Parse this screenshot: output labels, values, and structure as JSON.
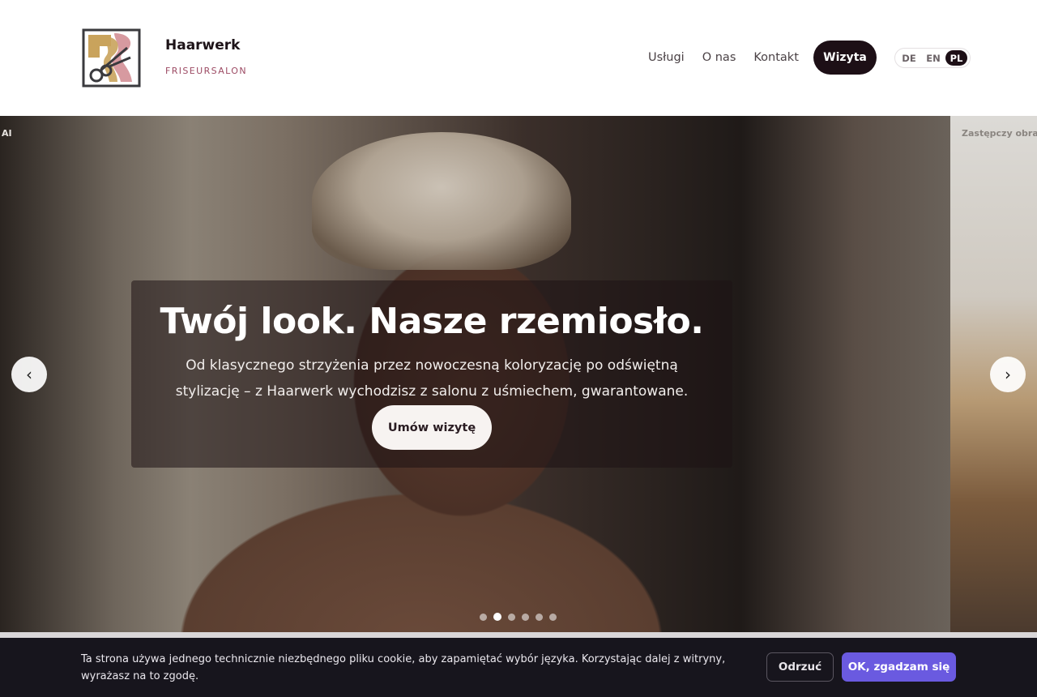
{
  "header": {
    "logo_icon": "scissors-logo-icon",
    "brand_name": "Haarwerk",
    "brand_sub": "FRISEURSALON",
    "nav": [
      "Usługi",
      "O nas",
      "Kontakt"
    ],
    "cta": "Wizyta",
    "languages": [
      "DE",
      "EN",
      "PL"
    ],
    "active_language": "PL"
  },
  "hero": {
    "tag_left": "AI",
    "tag_right": "Zastępczy obraz",
    "title": "Twój look. Nasze rzemiosło.",
    "text": "Od klasycznego strzyżenia przez nowoczesną koloryzację po odświętną stylizację – z Haarwerk wychodzisz z salonu z uśmiechem, gwarantowane.",
    "cta": "Umów wizytę",
    "prev_icon": "‹",
    "next_icon": "›",
    "slide_count": 6,
    "active_slide": 2
  },
  "cookie": {
    "text": "Ta strona używa jednego technicznie niezbędnego pliku cookie, aby zapamiętać wybór języka. Korzystając dalej z witryny, wyrażasz na to zgodę.",
    "decline": "Odrzuć",
    "accept": "OK, zgadzam się"
  },
  "colors": {
    "brand_dark": "#1d0f16",
    "brand_accent": "#9c4a63",
    "logo_gold": "#c9a35c",
    "logo_pink": "#d79aa0",
    "cookie_bg": "#17151d",
    "accept_button": "#6a5ae0"
  }
}
